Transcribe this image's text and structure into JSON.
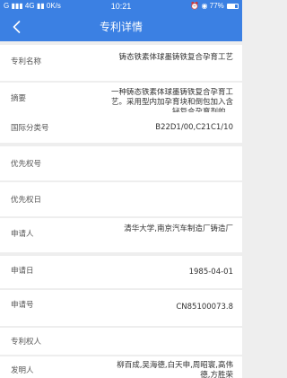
{
  "status_bar": {
    "carrier": "G",
    "signal": "4G",
    "speed": "0K/s",
    "time": "10:21",
    "battery": "77%",
    "battery_level": 0.77
  },
  "header": {
    "title": "专利详情",
    "back_icon": "chevron-left-icon"
  },
  "colors": {
    "accent": "#3b80e3",
    "page_background": "#eeeeee",
    "row_background": "#ffffff"
  },
  "fields": [
    {
      "label": "专利名称",
      "value": "铸态铁素体球墨铸铁复合孕育工艺"
    },
    {
      "label": "摘要",
      "value": "一种铸态铁素体球墨铸铁复合孕育工艺。采用型内加孕育块和倒包加入含铋复合孕育剂的…"
    },
    {
      "label": "国际分类号",
      "value": "B22D1/00,C21C1/10"
    },
    {
      "label": "优先权号",
      "value": ""
    },
    {
      "label": "优先权日",
      "value": ""
    },
    {
      "label": "申请人",
      "value": "清华大学,南京汽车制造厂铸造厂"
    },
    {
      "label": "申请日",
      "value": "1985-04-01"
    },
    {
      "label": "申请号",
      "value": "CN85100073.8"
    },
    {
      "label": "专利权人",
      "value": ""
    },
    {
      "label": "发明人",
      "value": "柳百成,吴海德,白天申,周昭寰,高伟德,方胜荣"
    }
  ]
}
